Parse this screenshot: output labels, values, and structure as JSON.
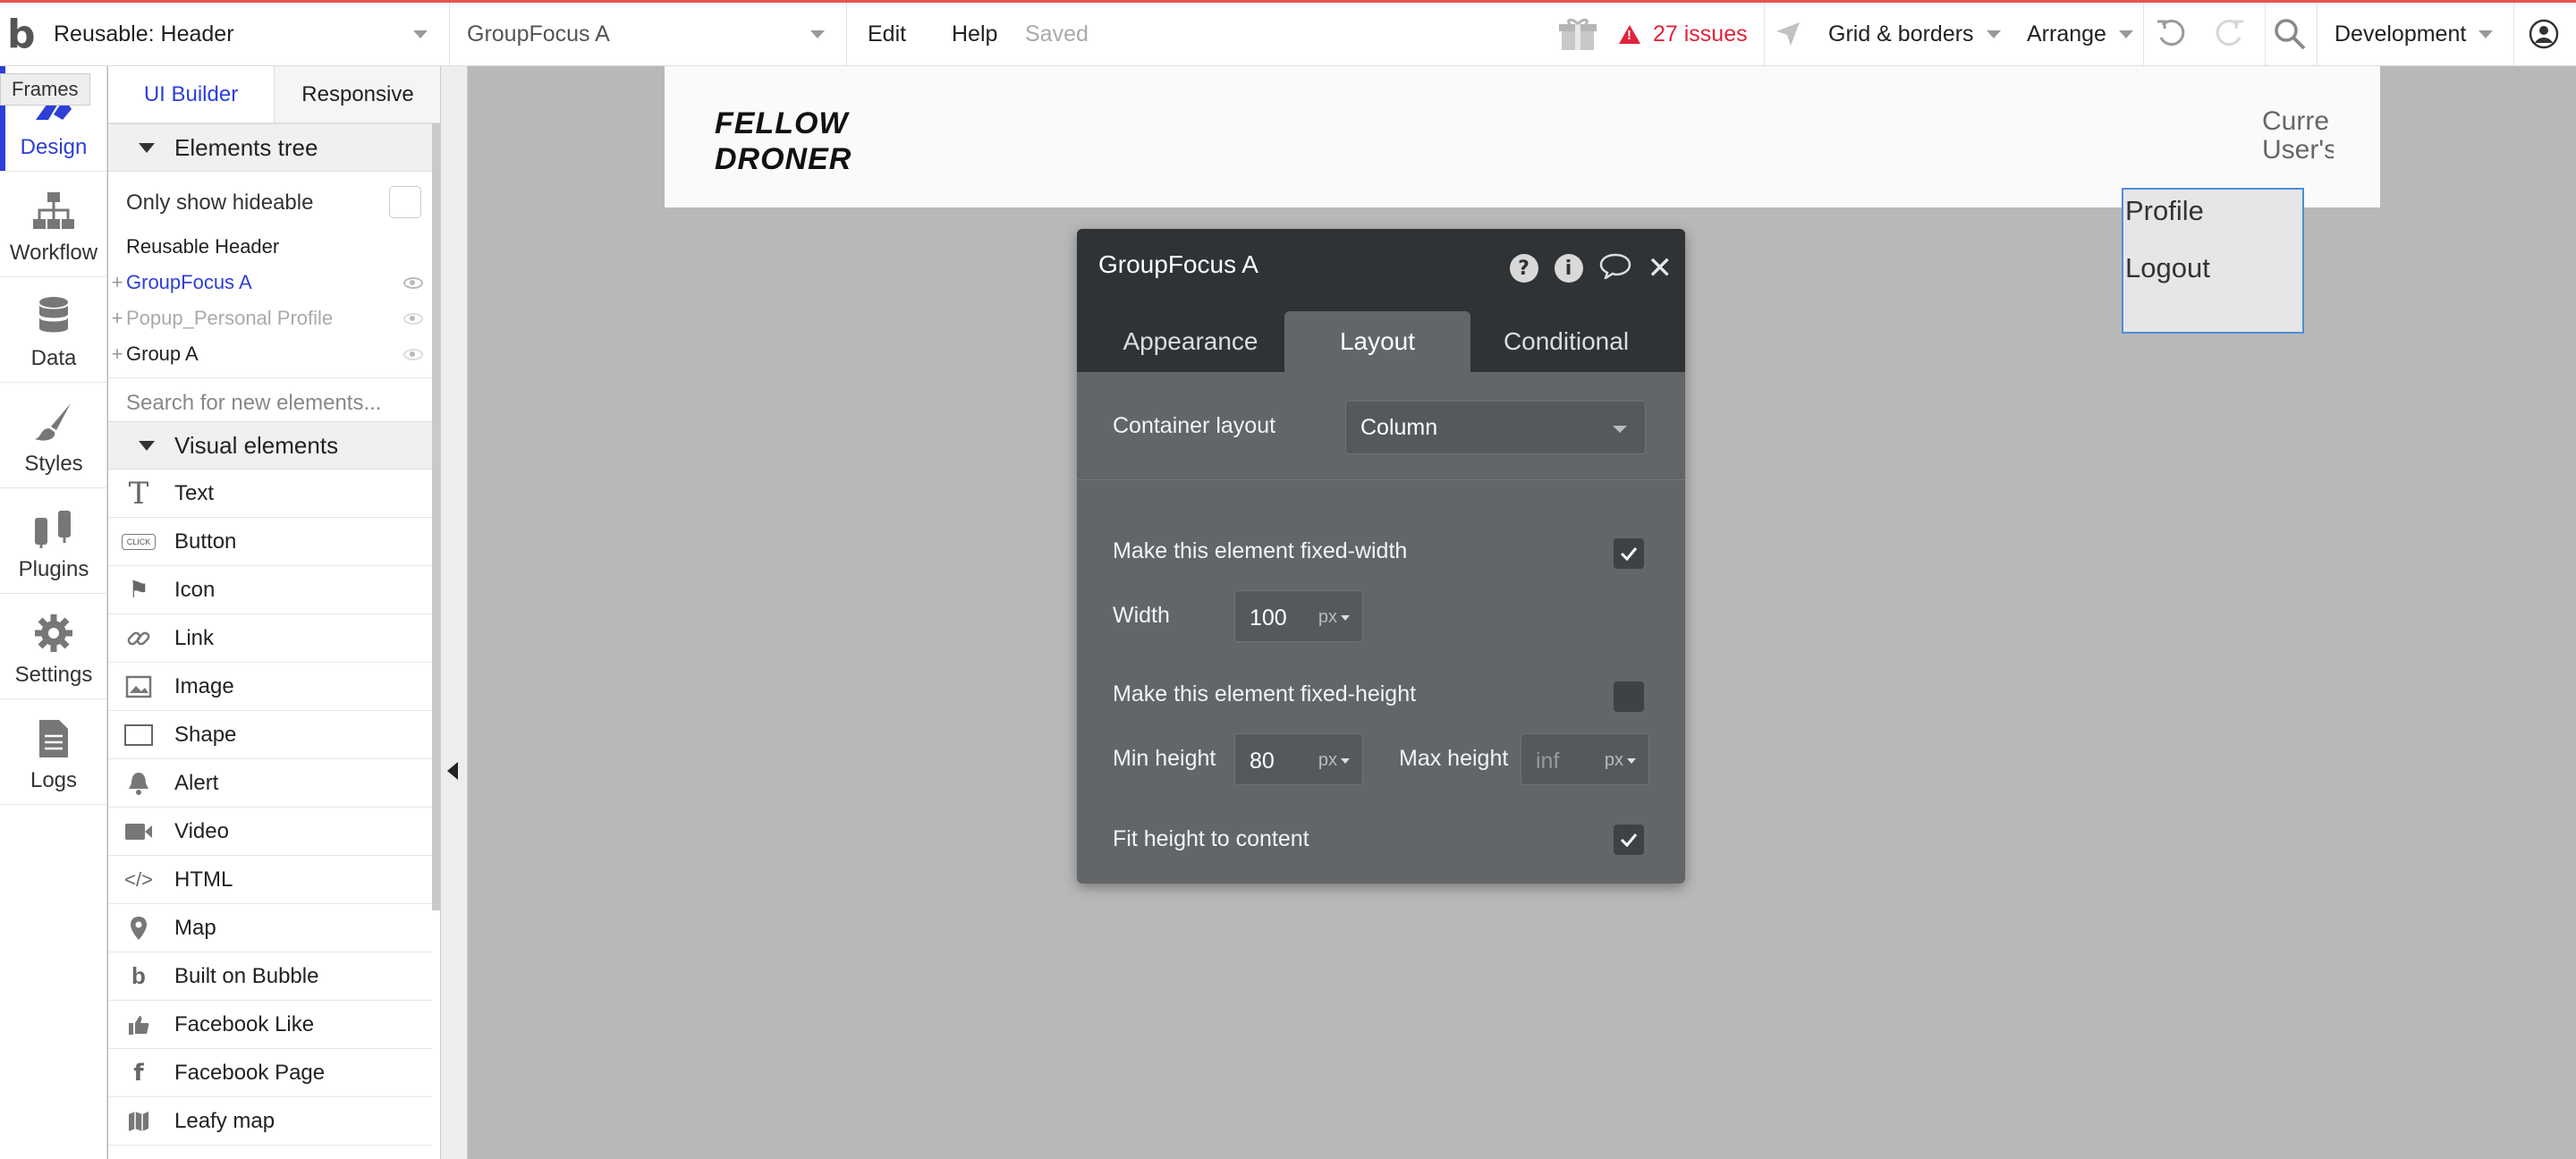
{
  "topbar": {
    "page_select": "Reusable: Header",
    "element_select": "GroupFocus A",
    "menu_edit": "Edit",
    "menu_help": "Help",
    "save_status": "Saved",
    "issues": "27 issues",
    "grid_borders": "Grid & borders",
    "arrange": "Arrange",
    "env": "Development",
    "accent_color": "#e0233b"
  },
  "rail": {
    "tooltip": "Frames",
    "items": [
      {
        "label": "Design",
        "icon": "design-icon"
      },
      {
        "label": "Workflow",
        "icon": "workflow-icon"
      },
      {
        "label": "Data",
        "icon": "database-icon"
      },
      {
        "label": "Styles",
        "icon": "brush-icon"
      },
      {
        "label": "Plugins",
        "icon": "plug-icon"
      },
      {
        "label": "Settings",
        "icon": "gear-icon"
      },
      {
        "label": "Logs",
        "icon": "document-icon"
      }
    ]
  },
  "palette": {
    "tabs": [
      "UI Builder",
      "Responsive"
    ],
    "elements_tree_title": "Elements tree",
    "only_hideable": "Only show hideable",
    "tree": {
      "root": "Reusable Header",
      "items": [
        "GroupFocus A",
        "Popup_Personal Profile",
        "Group A"
      ]
    },
    "search_placeholder": "Search for new elements...",
    "visual_title": "Visual elements",
    "visual_elements": [
      {
        "label": "Text",
        "icon": "T"
      },
      {
        "label": "Button",
        "icon": "CLICK"
      },
      {
        "label": "Icon",
        "icon": "⚑"
      },
      {
        "label": "Link",
        "icon": "🔗"
      },
      {
        "label": "Image",
        "icon": "▣"
      },
      {
        "label": "Shape",
        "icon": "▭"
      },
      {
        "label": "Alert",
        "icon": "🔔"
      },
      {
        "label": "Video",
        "icon": "▶"
      },
      {
        "label": "HTML",
        "icon": "</>"
      },
      {
        "label": "Map",
        "icon": "⚲"
      },
      {
        "label": "Built on Bubble",
        "icon": "b"
      },
      {
        "label": "Facebook Like",
        "icon": "👍"
      },
      {
        "label": "Facebook Page",
        "icon": "f"
      },
      {
        "label": "Leafy map",
        "icon": "▤"
      }
    ]
  },
  "canvas": {
    "brand_line1": "FELLOW",
    "brand_line2": "DRONER",
    "current_user_line1": "Curre",
    "current_user_line2": "User's",
    "dropdown_items": [
      "Profile",
      "Logout"
    ]
  },
  "editor": {
    "title": "GroupFocus A",
    "tabs": [
      "Appearance",
      "Layout",
      "Conditional"
    ],
    "container_layout_label": "Container layout",
    "container_layout_value": "Column",
    "fixed_width_label": "Make this element fixed-width",
    "width_label": "Width",
    "width_value": "100",
    "unit": "px",
    "fixed_height_label": "Make this element fixed-height",
    "min_height_label": "Min height",
    "min_height_value": "80",
    "max_height_label": "Max height",
    "max_height_placeholder": "inf",
    "fit_height_label": "Fit height to content"
  }
}
